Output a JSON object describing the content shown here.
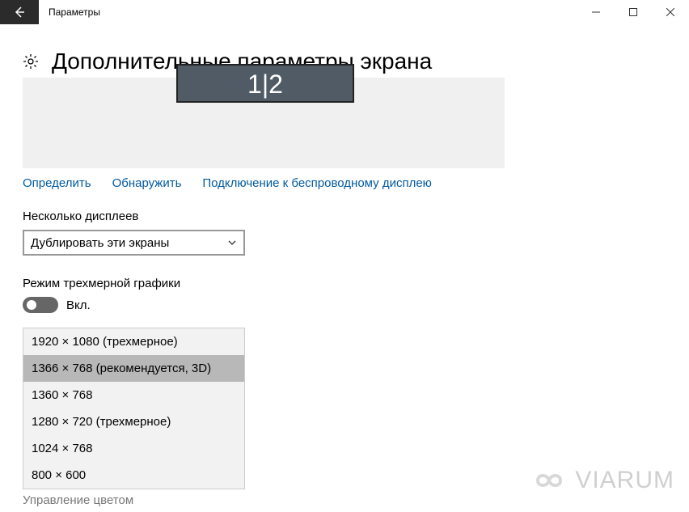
{
  "window": {
    "title": "Параметры",
    "page_title": "Дополнительные параметры экрана"
  },
  "monitor_label": "1|2",
  "links": {
    "identify": "Определить",
    "detect": "Обнаружить",
    "wireless": "Подключение к беспроводному дисплею"
  },
  "multi_displays": {
    "label": "Несколько дисплеев",
    "selected": "Дублировать эти экраны"
  },
  "graphics_mode": {
    "label": "Режим трехмерной графики",
    "state_label": "Вкл."
  },
  "resolutions": [
    {
      "label": "1920 × 1080 (трехмерное)",
      "selected": false
    },
    {
      "label": "1366 × 768 (рекомендуется, 3D)",
      "selected": true
    },
    {
      "label": "1360 × 768",
      "selected": false
    },
    {
      "label": "1280 × 720 (трехмерное)",
      "selected": false
    },
    {
      "label": "1024 × 768",
      "selected": false
    },
    {
      "label": "800 × 600",
      "selected": false
    }
  ],
  "bottom_link": "Управление цветом",
  "watermark": "VIARUM"
}
